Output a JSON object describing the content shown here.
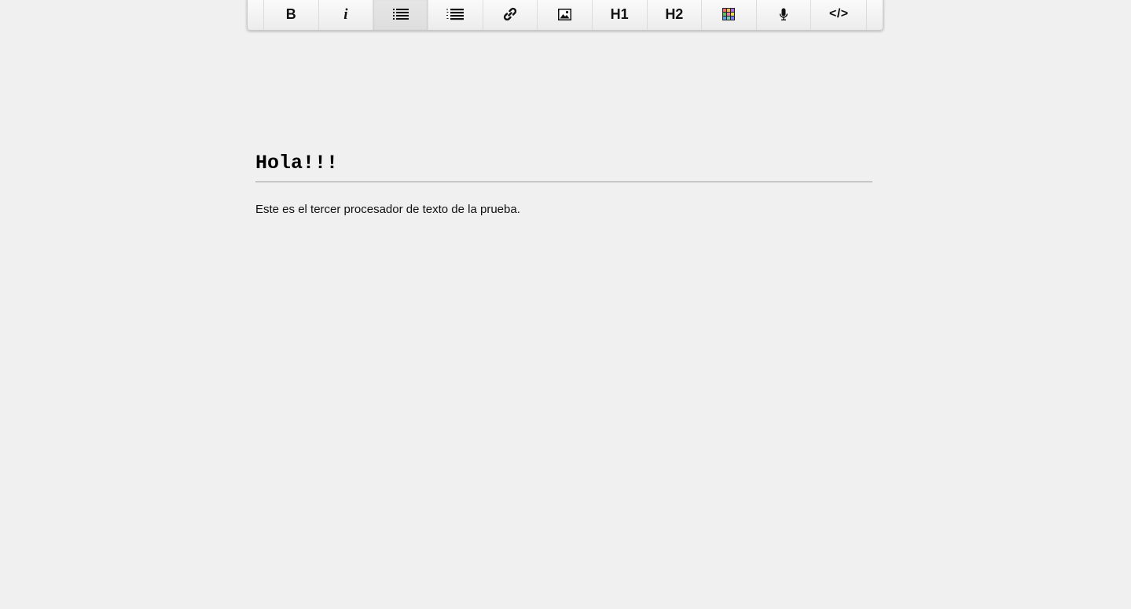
{
  "toolbar": {
    "buttons": [
      {
        "id": "bold",
        "label": "B",
        "icon": "bold-icon"
      },
      {
        "id": "italic",
        "label": "i",
        "icon": "italic-icon"
      },
      {
        "id": "unordered-list",
        "label": "",
        "icon": "bulleted-list-icon",
        "active": true
      },
      {
        "id": "ordered-list",
        "label": "",
        "icon": "numbered-list-icon"
      },
      {
        "id": "link",
        "label": "",
        "icon": "link-icon"
      },
      {
        "id": "image",
        "label": "",
        "icon": "image-icon"
      },
      {
        "id": "h1",
        "label": "H1",
        "icon": "heading1-icon"
      },
      {
        "id": "h2",
        "label": "H2",
        "icon": "heading2-icon"
      },
      {
        "id": "table",
        "label": "",
        "icon": "color-grid-icon"
      },
      {
        "id": "voice",
        "label": "",
        "icon": "microphone-icon"
      },
      {
        "id": "source",
        "label": "</>",
        "icon": "code-icon"
      }
    ]
  },
  "document": {
    "heading": "Hola!!!",
    "paragraph": "Este es el tercer procesador de texto de la prueba."
  }
}
